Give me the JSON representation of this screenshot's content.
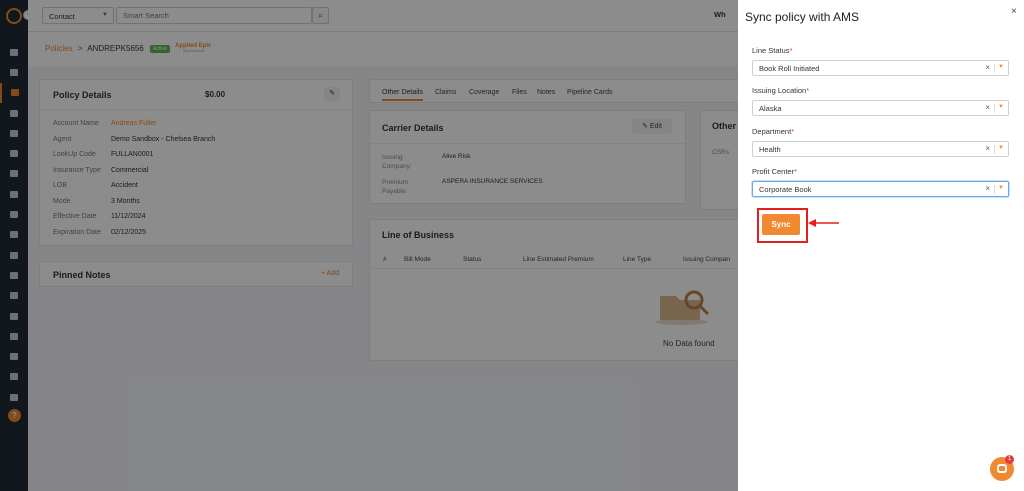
{
  "topbar": {
    "contact_select": "Contact",
    "search_placeholder": "Smart Search",
    "right_text": "Wh"
  },
  "breadcrumb": {
    "root": "Policies",
    "separator": ">",
    "policy_number": "ANDREPK5656",
    "status_badge": "Active",
    "integration_logo": "Applied Epic",
    "integration_sub": "Synchronized"
  },
  "policy_details": {
    "title": "Policy Details",
    "amount": "$0.00",
    "rows": [
      {
        "label": "Account Name",
        "value": "Andreas Fuller"
      },
      {
        "label": "Agent",
        "value": "Demo Sandbox - Chelsea Branch"
      },
      {
        "label": "LookUp Code",
        "value": "FULLAN0001"
      },
      {
        "label": "Insurance Type",
        "value": "Commercial"
      },
      {
        "label": "LOB",
        "value": "Accident"
      },
      {
        "label": "Mode",
        "value": "3 Months"
      },
      {
        "label": "Effective Date",
        "value": "11/12/2024"
      },
      {
        "label": "Expiration Date",
        "value": "02/12/2025"
      }
    ]
  },
  "pinned_notes": {
    "title": "Pinned Notes",
    "add_label": "+ Add"
  },
  "tabs": [
    "Other Details",
    "Claims",
    "Coverage",
    "Files",
    "Notes",
    "Pipeline Cards"
  ],
  "carrier_details": {
    "title": "Carrier Details",
    "edit_label": "Edit",
    "rows": [
      {
        "label": "Issuing Company:",
        "value": "Alive Risk"
      },
      {
        "label": "Premium Payable:",
        "value": "ASPERA INSURANCE SERVICES"
      }
    ]
  },
  "other_card": {
    "title": "Other",
    "csr_label": "CSRs"
  },
  "line_of_business": {
    "title": "Line of Business",
    "columns": [
      "#",
      "Bill Mode",
      "Status",
      "Line Estimated Premium",
      "Line Type",
      "Issuing Compan"
    ],
    "empty_text": "No Data found"
  },
  "drawer": {
    "title": "Sync policy with AMS",
    "close_label": "×",
    "fields": [
      {
        "label": "Line Status",
        "value": "Book Roll Initiated"
      },
      {
        "label": "Issuing Location",
        "value": "Alaska"
      },
      {
        "label": "Department",
        "value": "Health"
      },
      {
        "label": "Profit Center",
        "value": "Corporate Book"
      }
    ],
    "required_mark": "*",
    "clear_glyph": "×",
    "sync_label": "Sync"
  },
  "chat": {
    "badge_count": "1"
  },
  "colors": {
    "accent": "#f0892f",
    "sidebar": "#1f2a33",
    "highlight_frame": "#e41e1e"
  }
}
